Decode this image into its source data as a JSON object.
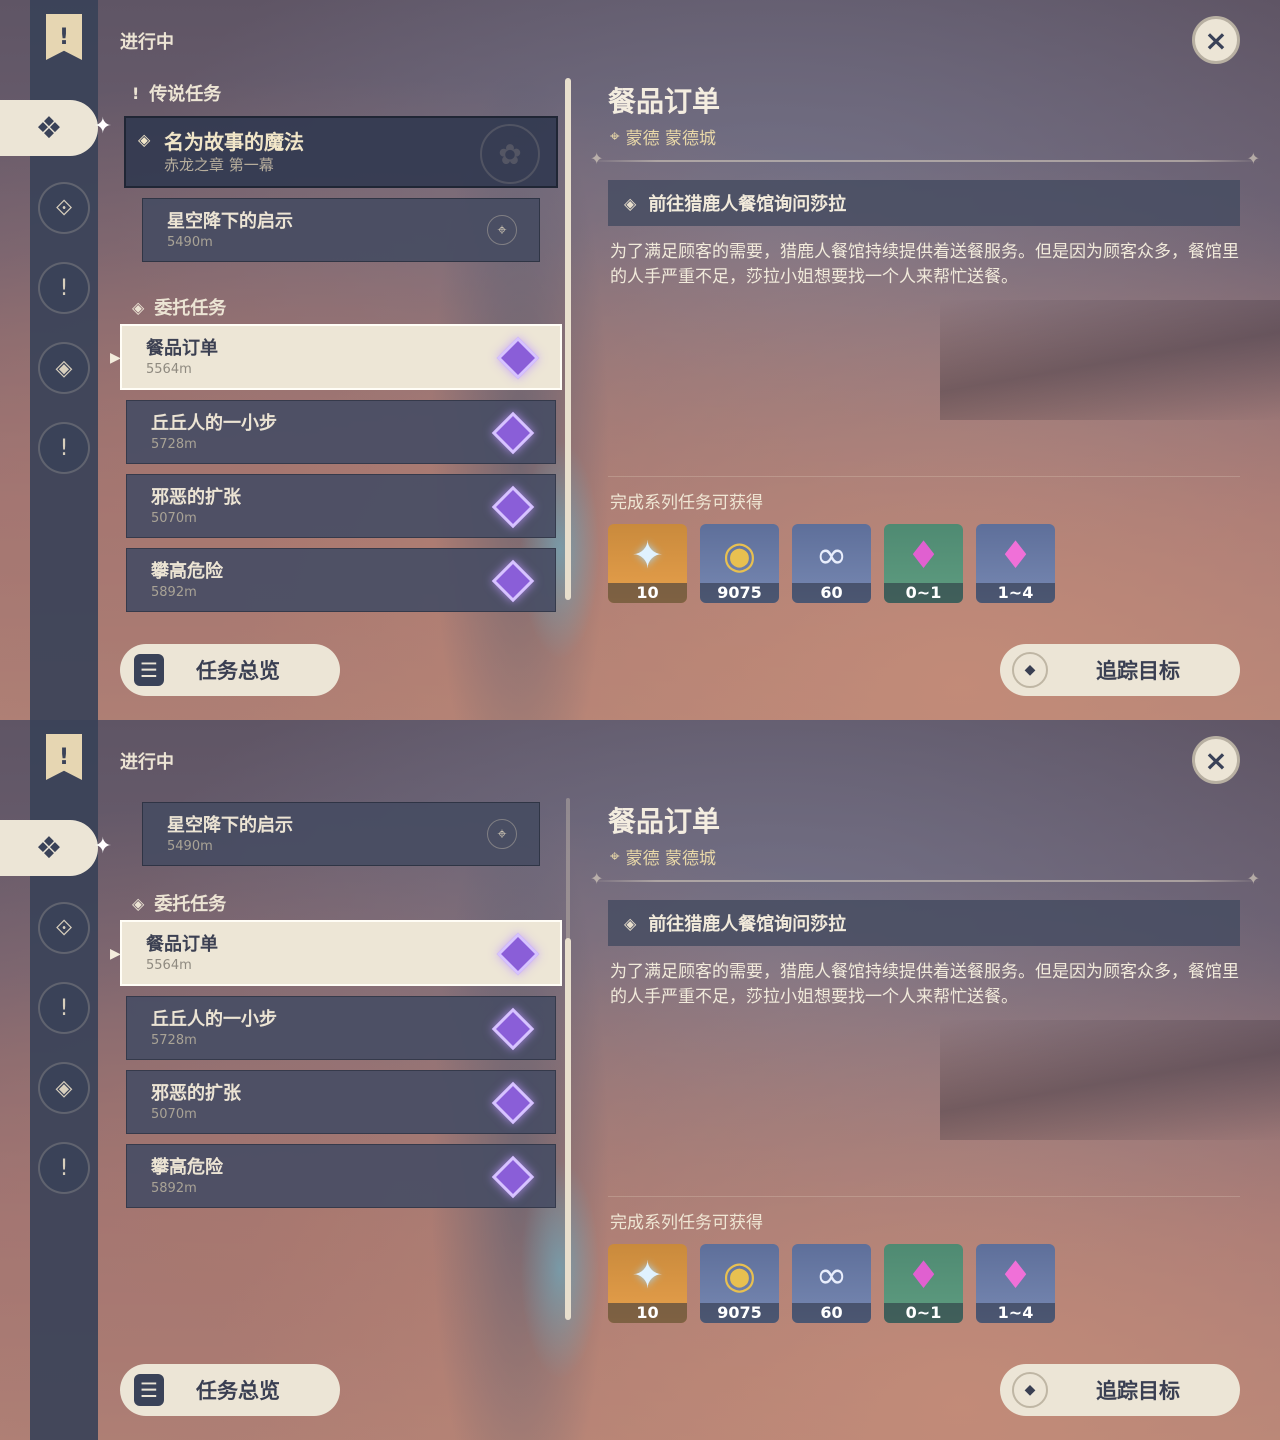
{
  "section_title": "进行中",
  "close_icon": "×",
  "strip": {
    "banner_glyph": "!",
    "active_glyph": "❖",
    "active_spark": "✦",
    "icons": [
      "⟐",
      "!",
      "◈",
      "!"
    ]
  },
  "list": {
    "legend_category": "传说任务",
    "legend_icon": "!",
    "story": {
      "title": "名为故事的魔法",
      "subtitle": "赤龙之章 第一幕",
      "icon": "◈",
      "emblem": "✿"
    },
    "story_sub": {
      "title": "星空降下的启示",
      "distance": "5490m",
      "pin": "⌖"
    },
    "commission_category": "委托任务",
    "commission_icon": "◈",
    "arrow": "▶",
    "quests": [
      {
        "title": "餐品订单",
        "distance": "5564m"
      },
      {
        "title": "丘丘人的一小步",
        "distance": "5728m"
      },
      {
        "title": "邪恶的扩张",
        "distance": "5070m"
      },
      {
        "title": "攀高危险",
        "distance": "5892m"
      }
    ]
  },
  "detail": {
    "title": "餐品订单",
    "location_icon": "⌖",
    "location": "蒙德 蒙德城",
    "objective_icon": "◈",
    "objective": "前往猎鹿人餐馆询问莎拉",
    "description": "为了满足顾客的需要，猎鹿人餐馆持续提供着送餐服务。但是因为顾客众多，餐馆里的人手严重不足，莎拉小姐想要找一个人来帮忙送餐。",
    "rewards_label": "完成系列任务可获得",
    "rewards": [
      {
        "glyph": "✦",
        "count": "10"
      },
      {
        "glyph": "◉",
        "count": "9075"
      },
      {
        "glyph": "∞",
        "count": "60"
      },
      {
        "glyph": "♦",
        "count": "0~1"
      },
      {
        "glyph": "♦",
        "count": "1~4"
      }
    ]
  },
  "buttons": {
    "overview_icon": "☰",
    "overview": "任务总览",
    "track_icon": "◆",
    "track": "追踪目标"
  }
}
